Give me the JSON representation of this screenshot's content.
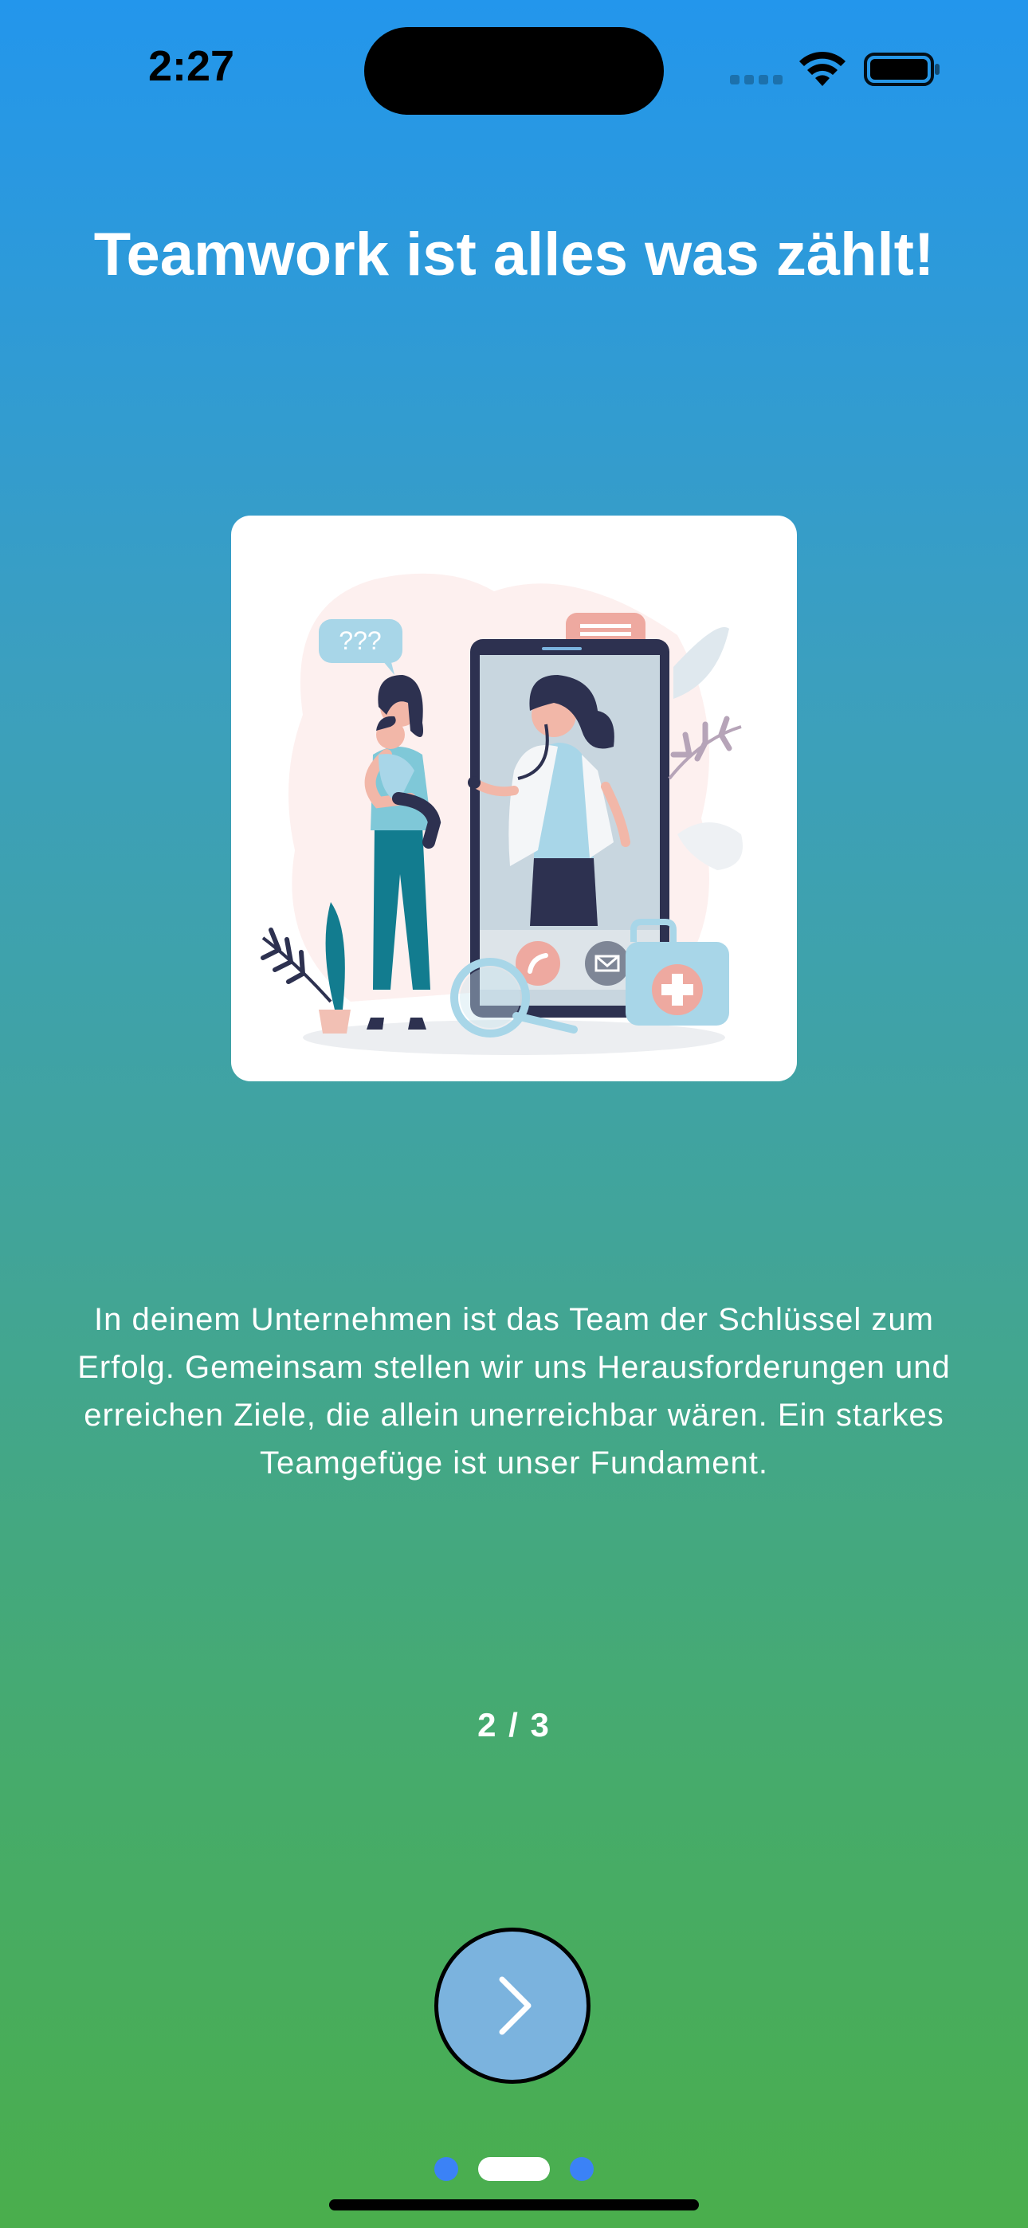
{
  "status_bar": {
    "time": "2:27"
  },
  "onboarding": {
    "title": "Teamwork ist alles was zählt!",
    "description": "In deinem Unternehmen ist das Team der Schlüssel zum Erfolg. Gemeinsam stellen wir uns Herausforderungen und erreichen Ziele, die allein unerreichbar wären. Ein starkes Teamgefüge ist unser Fundament.",
    "page_counter": "2 / 3",
    "current_page": 2,
    "total_pages": 3,
    "speech_bubble_text": "???"
  },
  "next_button": {
    "icon": "chevron-right-icon"
  },
  "colors": {
    "gradient_top": "#2396ec",
    "gradient_bottom": "#4aae4c",
    "button_fill": "#7bb3de",
    "dot_inactive": "#3b82f6",
    "dot_active": "#ffffff"
  }
}
